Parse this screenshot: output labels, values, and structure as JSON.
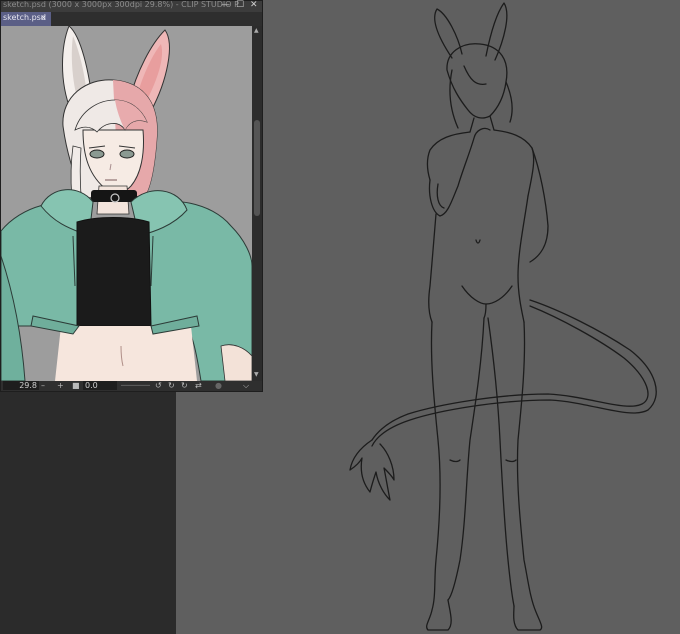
{
  "window": {
    "title": "sketch.psd (3000 x 3000px 300dpi 29.8%) - CLIP STUDIO P",
    "minimize_icon": "minimize-icon",
    "maximize_icon": "maximize-icon",
    "close_icon": "close-icon"
  },
  "tab": {
    "label": "sketch.psd",
    "close_glyph": "×"
  },
  "status": {
    "zoom": "29.8",
    "rotation": "0.0"
  },
  "colors": {
    "canvas_bg": "#5f5f5f",
    "panel_dark": "#2b2b2b",
    "tab_active": "#5b5f86",
    "jacket": "#79b9a6",
    "skin": "#f6ebe4",
    "hair_pink": "#e3a4a4"
  }
}
